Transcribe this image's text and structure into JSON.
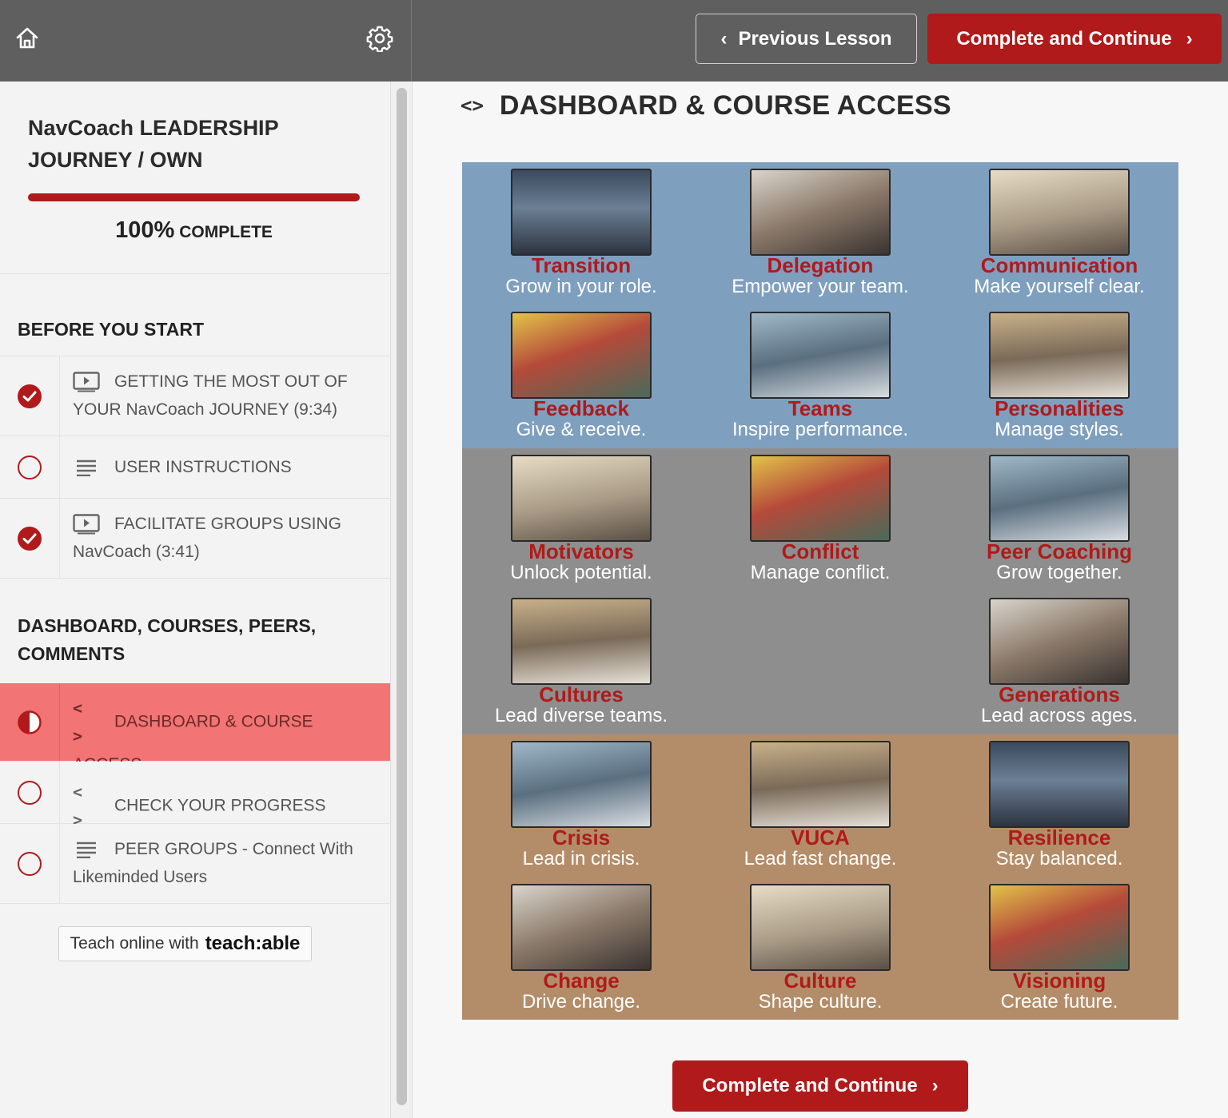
{
  "topbar": {
    "home_icon": "home-icon",
    "settings_icon": "gear-icon",
    "previous_label": "Previous Lesson",
    "complete_label": "Complete and Continue"
  },
  "course": {
    "title": "NavCoach LEADERSHIP JOURNEY / OWN",
    "progress_percent": "100%",
    "progress_label": "COMPLETE",
    "progress_fraction": 1.0
  },
  "sections": [
    {
      "title": "BEFORE YOU START",
      "lessons": [
        {
          "title": "GETTING THE MOST OUT OF YOUR NavCoach JOURNEY (9:34)",
          "type": "video",
          "status": "complete"
        },
        {
          "title": "USER INSTRUCTIONS",
          "type": "text",
          "status": "incomplete"
        },
        {
          "title": "FACILITATE GROUPS USING NavCoach (3:41)",
          "type": "video",
          "status": "complete"
        }
      ]
    },
    {
      "title": "DASHBOARD, COURSES, PEERS, COMMENTS",
      "lessons": [
        {
          "title": "DASHBOARD & COURSE ACCESS",
          "type": "code",
          "status": "in-progress",
          "active": true
        },
        {
          "title": "CHECK YOUR PROGRESS",
          "type": "code",
          "status": "incomplete"
        },
        {
          "title": "PEER GROUPS - Connect With Likeminded Users",
          "type": "text",
          "status": "incomplete"
        }
      ]
    }
  ],
  "teachable": {
    "prefix": "Teach online with",
    "brand": "teach:able"
  },
  "lesson": {
    "title": "DASHBOARD & COURSE ACCESS",
    "icon": "code-icon"
  },
  "dashboard": {
    "bands": [
      {
        "color": "#7f9fbf",
        "tiles": [
          {
            "name": "Transition",
            "tagline": "Grow in your role."
          },
          {
            "name": "Delegation",
            "tagline": "Empower your team."
          },
          {
            "name": "Communication",
            "tagline": "Make yourself clear."
          },
          {
            "name": "Feedback",
            "tagline": "Give & receive."
          },
          {
            "name": "Teams",
            "tagline": "Inspire performance."
          },
          {
            "name": "Personalities",
            "tagline": "Manage styles."
          }
        ]
      },
      {
        "color": "#8e8e8e",
        "tiles": [
          {
            "name": "Motivators",
            "tagline": "Unlock potential."
          },
          {
            "name": "Conflict",
            "tagline": "Manage conflict."
          },
          {
            "name": "Peer Coaching",
            "tagline": "Grow together."
          },
          {
            "name": "Cultures",
            "tagline": "Lead diverse teams."
          },
          null,
          {
            "name": "Generations",
            "tagline": "Lead across ages."
          }
        ]
      },
      {
        "color": "#b38d69",
        "tiles": [
          {
            "name": "Crisis",
            "tagline": "Lead in crisis."
          },
          {
            "name": "VUCA",
            "tagline": "Lead fast change."
          },
          {
            "name": "Resilience",
            "tagline": "Stay balanced."
          },
          {
            "name": "Change",
            "tagline": "Drive change."
          },
          {
            "name": "Culture",
            "tagline": "Shape culture."
          },
          {
            "name": "Visioning",
            "tagline": "Create future."
          }
        ]
      }
    ]
  },
  "colors": {
    "accent": "#b01a1a",
    "active_row": "#f27474",
    "topbar": "#5f5f5f"
  }
}
